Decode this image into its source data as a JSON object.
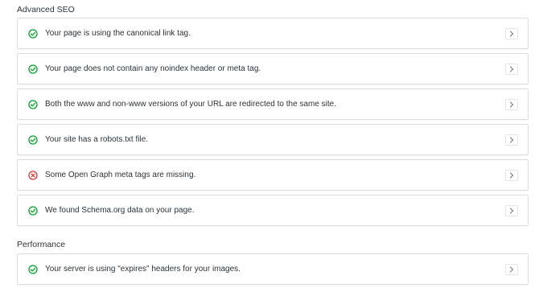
{
  "sections": [
    {
      "title": "Advanced SEO",
      "items": [
        {
          "status": "pass",
          "text": "Your page is using the canonical link tag."
        },
        {
          "status": "pass",
          "text": "Your page does not contain any noindex header or meta tag."
        },
        {
          "status": "pass",
          "text": "Both the www and non-www versions of your URL are redirected to the same site."
        },
        {
          "status": "pass",
          "text": "Your site has a robots.txt file."
        },
        {
          "status": "fail",
          "text": "Some Open Graph meta tags are missing."
        },
        {
          "status": "pass",
          "text": "We found Schema.org data on your page."
        }
      ]
    },
    {
      "title": "Performance",
      "items": [
        {
          "status": "pass",
          "text": "Your server is using \"expires\" headers for your images."
        }
      ]
    }
  ],
  "colors": {
    "pass": "#00a32a",
    "fail": "#d63638",
    "chevron": "#787c82"
  },
  "icons": {
    "pass": "check-circle-icon",
    "fail": "x-circle-icon",
    "expand": "chevron-right-icon"
  }
}
